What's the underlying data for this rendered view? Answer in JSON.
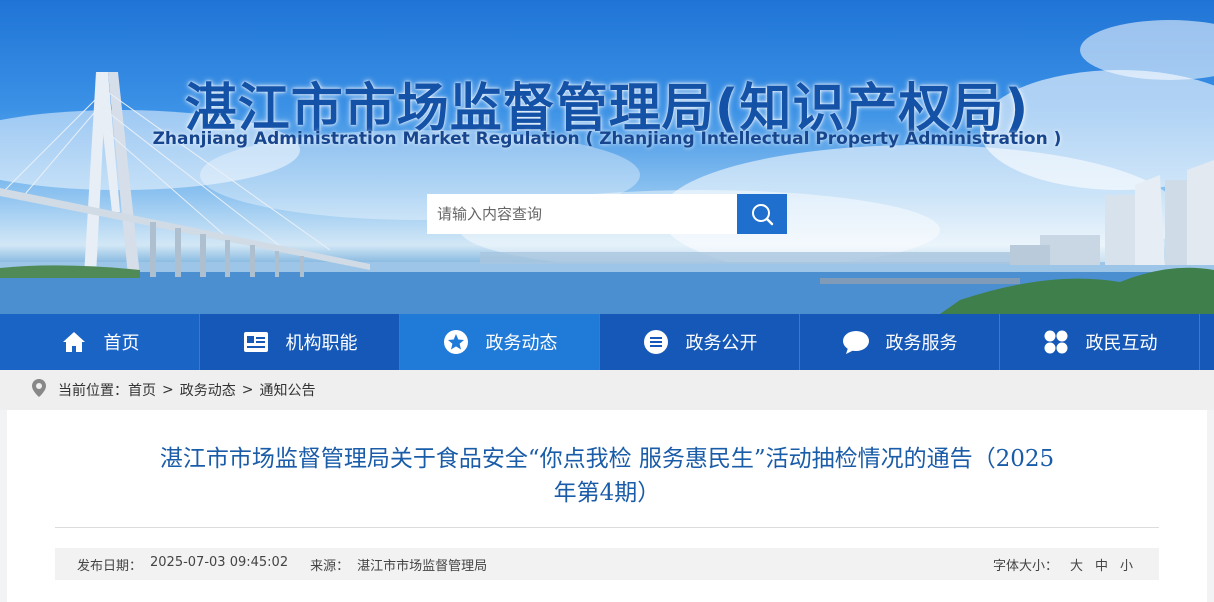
{
  "header": {
    "title_cn": "湛江市市场监督管理局(知识产权局)",
    "title_en": "Zhanjiang Administration Market Regulation ( Zhanjiang Intellectual Property Administration )"
  },
  "search": {
    "placeholder": "请输入内容查询",
    "button_icon": "search-icon"
  },
  "nav": {
    "items": [
      {
        "label": "首页",
        "icon": "home-icon"
      },
      {
        "label": "机构职能",
        "icon": "id-card-icon"
      },
      {
        "label": "政务动态",
        "icon": "star-icon"
      },
      {
        "label": "政务公开",
        "icon": "menu-circle-icon"
      },
      {
        "label": "政务服务",
        "icon": "chat-bubble-icon"
      },
      {
        "label": "政民互动",
        "icon": "grid-icon"
      }
    ],
    "active": "政务动态"
  },
  "breadcrumb": {
    "prefix": "当前位置：",
    "items": [
      "首页",
      "政务动态",
      "通知公告"
    ],
    "separator": ">"
  },
  "article": {
    "title_line1": "湛江市市场监督管理局关于食品安全“你点我检 服务惠民生”活动抽检情况的通告（2025",
    "title_line2": "年第4期）",
    "publish_label": "发布日期：",
    "publish_date": "2025-07-03 09:45:02",
    "source_label": "来源：",
    "source": "湛江市市场监督管理局",
    "font_size_label": "字体大小：",
    "font_sizes": [
      "大",
      "中",
      "小"
    ]
  },
  "colors": {
    "nav_bg": "#1558b8",
    "nav_active": "#1f7ad8",
    "title": "#1452a8",
    "article_title": "#1a5ca8"
  }
}
